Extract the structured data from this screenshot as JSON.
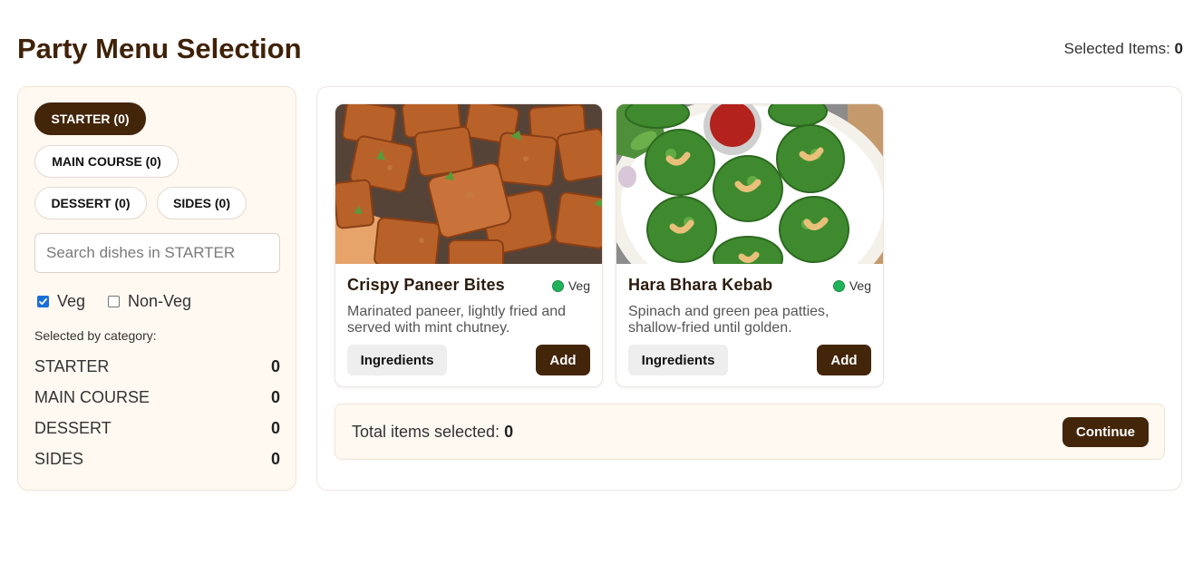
{
  "header": {
    "title": "Party Menu Selection",
    "selected_label": "Selected Items:",
    "selected_count": "0"
  },
  "sidebar": {
    "tabs": [
      {
        "label": "STARTER (0)",
        "active": true
      },
      {
        "label": "MAIN COURSE (0)",
        "active": false
      },
      {
        "label": "DESSERT (0)",
        "active": false
      },
      {
        "label": "SIDES (0)",
        "active": false
      }
    ],
    "search": {
      "placeholder": "Search dishes in STARTER",
      "value": ""
    },
    "filters": [
      {
        "label": "Veg",
        "checked": true
      },
      {
        "label": "Non-Veg",
        "checked": false
      }
    ],
    "category_caption": "Selected by category:",
    "categories": [
      {
        "name": "STARTER",
        "count": "0"
      },
      {
        "name": "MAIN COURSE",
        "count": "0"
      },
      {
        "name": "DESSERT",
        "count": "0"
      },
      {
        "name": "SIDES",
        "count": "0"
      }
    ]
  },
  "dishes": [
    {
      "name": "Crispy Paneer Bites",
      "badge": "Veg",
      "description": "Marinated paneer, lightly fried and served with mint chutney.",
      "ingredients_label": "Ingredients",
      "add_label": "Add"
    },
    {
      "name": "Hara Bhara Kebab",
      "badge": "Veg",
      "description": "Spinach and green pea patties, shallow-fried until golden.",
      "ingredients_label": "Ingredients",
      "add_label": "Add"
    }
  ],
  "footer": {
    "total_label": "Total items selected:",
    "total_count": "0",
    "continue_label": "Continue"
  },
  "colors": {
    "brand_brown": "#43250a",
    "panel_cream": "#fff9f2",
    "veg_green": "#22b35a",
    "checkbox_blue": "#1a6ed8"
  }
}
